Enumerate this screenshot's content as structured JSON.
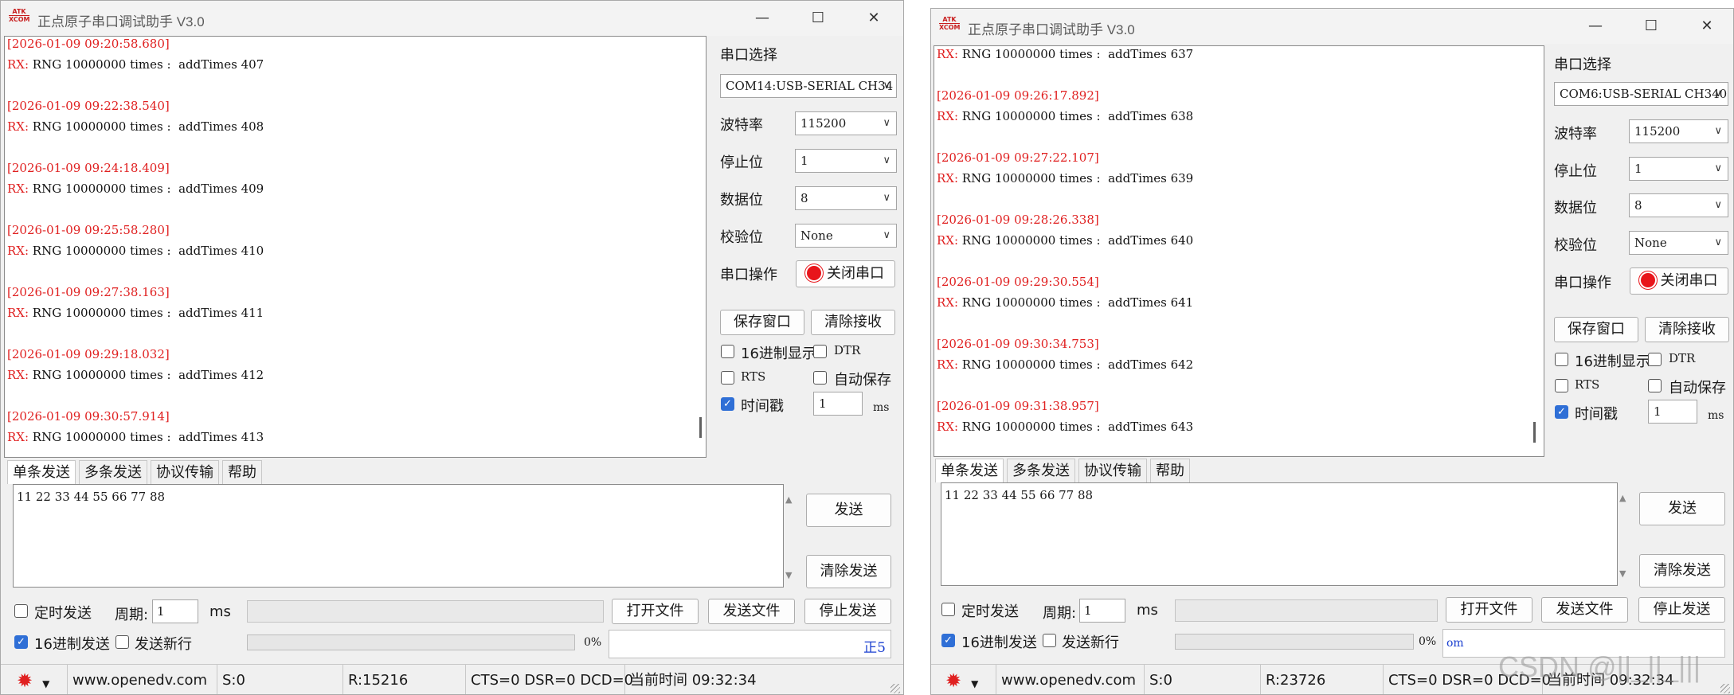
{
  "app_title": "正点原子串口调试助手 V3.0",
  "logo_text": {
    "line1": "ATK",
    "line2": "XCOM"
  },
  "window_controls": {
    "minimize": "—",
    "maximize": "☐",
    "close": "✕"
  },
  "labels": {
    "port_select": "串口选择",
    "baud": "波特率",
    "stop_bits": "停止位",
    "data_bits": "数据位",
    "parity": "校验位",
    "port_op": "串口操作",
    "close_port": "关闭串口",
    "save_window": "保存窗口",
    "clear_recv": "清除接收",
    "hex_display": "16进制显示",
    "dtr": "DTR",
    "rts": "RTS",
    "auto_save": "自动保存",
    "timestamp": "时间戳",
    "ms": "ms",
    "send": "发送",
    "clear_send": "清除发送",
    "timed_send": "定时发送",
    "period": "周期:",
    "open_file": "打开文件",
    "send_file": "发送文件",
    "stop_send": "停止发送",
    "hex_send": "16进制发送",
    "send_newline": "发送新行",
    "website": "www.openedv.com",
    "current_time": "当前时间 09:32:34",
    "cts_line": "CTS=0 DSR=0 DCD=0"
  },
  "tabs": [
    "单条发送",
    "多条发送",
    "协议传输",
    "帮助"
  ],
  "watermark": "CSDN @||_||_|||",
  "windows": [
    {
      "id": "left",
      "port": "COM14:USB-SERIAL CH34",
      "baud": "115200",
      "stop_bits": "1",
      "data_bits": "8",
      "parity": "None",
      "hex_display": false,
      "dtr": false,
      "rts": false,
      "auto_save": false,
      "timestamp_on": true,
      "timestamp_ms": "1",
      "send_text": "11 22 33 44 55 66 77 88",
      "timed_send": false,
      "period_value": "1",
      "hex_send": true,
      "send_newline": false,
      "progress_percent": 0,
      "progress_text": "0%",
      "info_text": "正5",
      "status_s": "S:0",
      "status_r": "R:15216",
      "log": [
        {
          "type": "ts",
          "text": "[2026-01-09 09:20:58.680]"
        },
        {
          "type": "rx",
          "label": "RX:",
          "text": " RNG 10000000 times :  addTimes 407"
        },
        {
          "type": "ts",
          "text": "[2026-01-09 09:22:38.540]"
        },
        {
          "type": "rx",
          "label": "RX:",
          "text": " RNG 10000000 times :  addTimes 408"
        },
        {
          "type": "ts",
          "text": "[2026-01-09 09:24:18.409]"
        },
        {
          "type": "rx",
          "label": "RX:",
          "text": " RNG 10000000 times :  addTimes 409"
        },
        {
          "type": "ts",
          "text": "[2026-01-09 09:25:58.280]"
        },
        {
          "type": "rx",
          "label": "RX:",
          "text": " RNG 10000000 times :  addTimes 410"
        },
        {
          "type": "ts",
          "text": "[2026-01-09 09:27:38.163]"
        },
        {
          "type": "rx",
          "label": "RX:",
          "text": " RNG 10000000 times :  addTimes 411"
        },
        {
          "type": "ts",
          "text": "[2026-01-09 09:29:18.032]"
        },
        {
          "type": "rx",
          "label": "RX:",
          "text": " RNG 10000000 times :  addTimes 412"
        },
        {
          "type": "ts",
          "text": "[2026-01-09 09:30:57.914]"
        },
        {
          "type": "rx",
          "label": "RX:",
          "text": " RNG 10000000 times :  addTimes 413"
        }
      ]
    },
    {
      "id": "right",
      "port": "COM6:USB-SERIAL CH340",
      "baud": "115200",
      "stop_bits": "1",
      "data_bits": "8",
      "parity": "None",
      "hex_display": false,
      "dtr": false,
      "rts": false,
      "auto_save": false,
      "timestamp_on": true,
      "timestamp_ms": "1",
      "send_text": "11 22 33 44 55 66 77 88",
      "timed_send": false,
      "period_value": "1",
      "hex_send": true,
      "send_newline": false,
      "progress_percent": 0,
      "progress_text": "0%",
      "info_text": "om",
      "status_s": "S:0",
      "status_r": "R:23726",
      "log": [
        {
          "type": "rx",
          "label": "RX:",
          "text": " RNG 10000000 times :  addTimes 637"
        },
        {
          "type": "ts",
          "text": "[2026-01-09 09:26:17.892]"
        },
        {
          "type": "rx",
          "label": "RX:",
          "text": " RNG 10000000 times :  addTimes 638"
        },
        {
          "type": "ts",
          "text": "[2026-01-09 09:27:22.107]"
        },
        {
          "type": "rx",
          "label": "RX:",
          "text": " RNG 10000000 times :  addTimes 639"
        },
        {
          "type": "ts",
          "text": "[2026-01-09 09:28:26.338]"
        },
        {
          "type": "rx",
          "label": "RX:",
          "text": " RNG 10000000 times :  addTimes 640"
        },
        {
          "type": "ts",
          "text": "[2026-01-09 09:29:30.554]"
        },
        {
          "type": "rx",
          "label": "RX:",
          "text": " RNG 10000000 times :  addTimes 641"
        },
        {
          "type": "ts",
          "text": "[2026-01-09 09:30:34.753]"
        },
        {
          "type": "rx",
          "label": "RX:",
          "text": " RNG 10000000 times :  addTimes 642"
        },
        {
          "type": "ts",
          "text": "[2026-01-09 09:31:38.957]"
        },
        {
          "type": "rx",
          "label": "RX:",
          "text": " RNG 10000000 times :  addTimes 643"
        }
      ]
    }
  ]
}
